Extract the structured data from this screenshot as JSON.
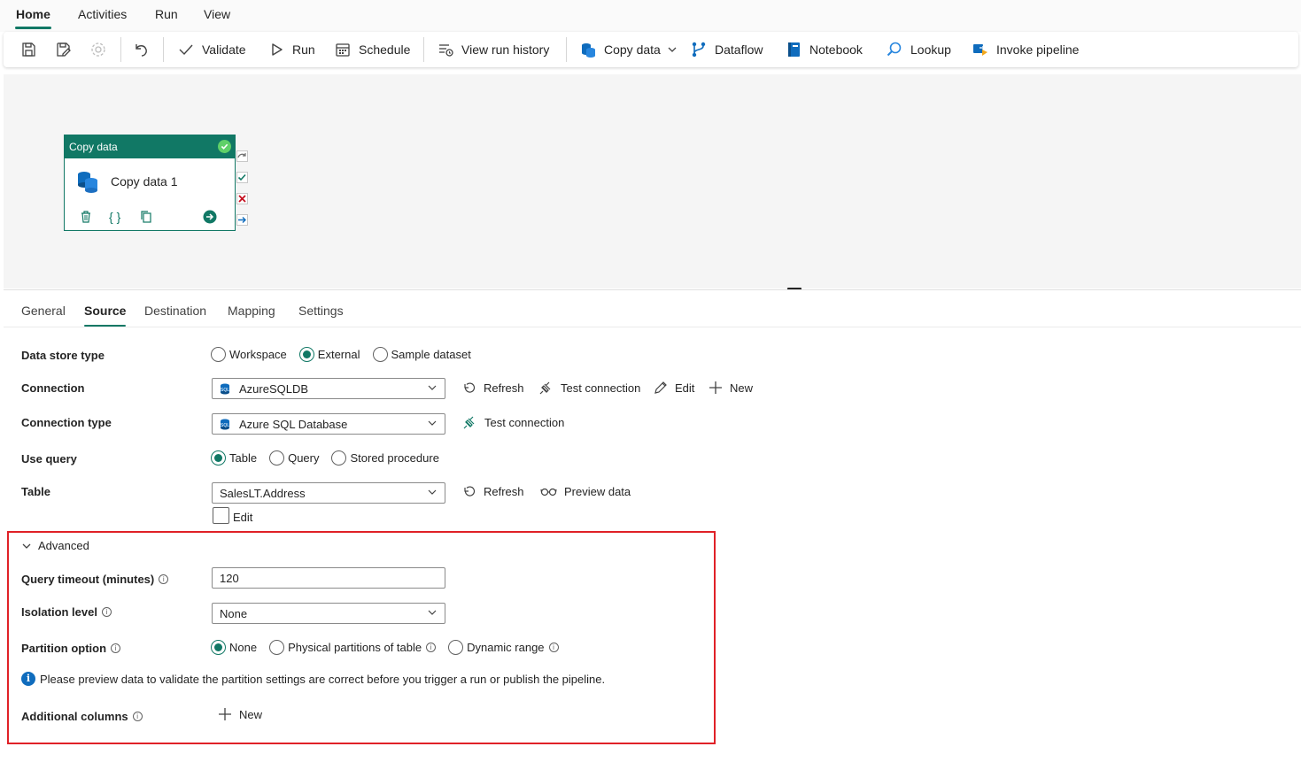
{
  "menu": {
    "tabs": [
      "Home",
      "Activities",
      "Run",
      "View"
    ],
    "active_tab": "Home"
  },
  "toolbar": {
    "save_icon": "save-icon",
    "save_as_icon": "save-as-icon",
    "settings_icon": "gear-icon",
    "undo_icon": "undo-icon",
    "validate": "Validate",
    "run": "Run",
    "schedule": "Schedule",
    "view_run_history": "View run history",
    "copy_data": "Copy data",
    "dataflow": "Dataflow",
    "notebook": "Notebook",
    "lookup": "Lookup",
    "invoke_pipeline": "Invoke pipeline"
  },
  "canvas": {
    "node": {
      "type_label": "Copy data",
      "name": "Copy data 1",
      "status": "succeeded"
    }
  },
  "properties": {
    "tabs": [
      "General",
      "Source",
      "Destination",
      "Mapping",
      "Settings"
    ],
    "active_tab": "Source",
    "data_store_type": {
      "label": "Data store type",
      "options": [
        "Workspace",
        "External",
        "Sample dataset"
      ],
      "selected": "External"
    },
    "connection": {
      "label": "Connection",
      "value": "AzureSQLDB",
      "refresh": "Refresh",
      "test_connection": "Test connection",
      "edit": "Edit",
      "new": "New"
    },
    "connection_type": {
      "label": "Connection type",
      "value": "Azure SQL Database",
      "test_connection": "Test connection"
    },
    "use_query": {
      "label": "Use query",
      "options": [
        "Table",
        "Query",
        "Stored procedure"
      ],
      "selected": "Table"
    },
    "table": {
      "label": "Table",
      "value": "SalesLT.Address",
      "refresh": "Refresh",
      "preview_data": "Preview data",
      "edit_checkbox": "Edit"
    },
    "advanced": {
      "label": "Advanced",
      "expanded": true,
      "query_timeout": {
        "label": "Query timeout (minutes)",
        "value": "120"
      },
      "isolation_level": {
        "label": "Isolation level",
        "value": "None"
      },
      "partition_option": {
        "label": "Partition option",
        "options": [
          "None",
          "Physical partitions of table",
          "Dynamic range"
        ],
        "selected": "None"
      },
      "info_message": "Please preview data to validate the partition settings are correct before you trigger a run or publish the pipeline.",
      "additional_columns": {
        "label": "Additional columns",
        "new": "New"
      }
    }
  },
  "colors": {
    "accent": "#117865",
    "highlight_border": "#e02127",
    "info": "#0f6cbd"
  }
}
